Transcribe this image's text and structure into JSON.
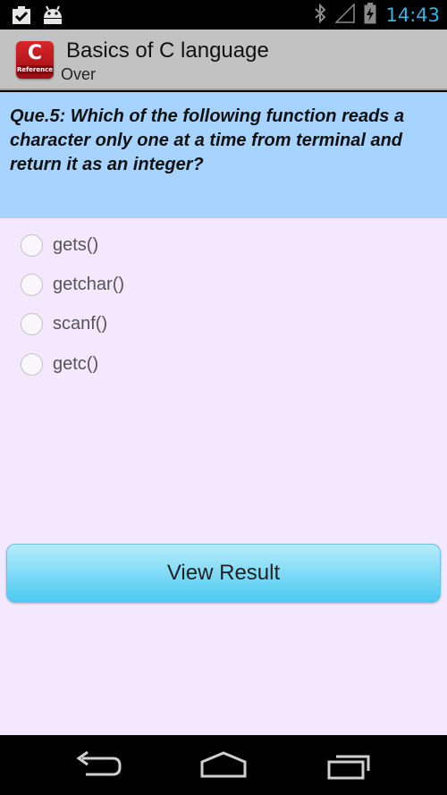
{
  "status_bar": {
    "time": "14:43",
    "icons": [
      "clipboard-check-icon",
      "android-icon",
      "bluetooth-icon",
      "signal-icon",
      "battery-charging-icon"
    ]
  },
  "action_bar": {
    "title": "Basics of C language",
    "subtitle": "Over",
    "app_icon": {
      "letter": "C",
      "caption": "Reference",
      "color": "#c4161c"
    }
  },
  "question": {
    "text": "Que.5: Which of the following function reads a character only one at a time from terminal and return it as an integer?"
  },
  "options": [
    {
      "label": "gets()",
      "selected": false
    },
    {
      "label": "getchar()",
      "selected": false
    },
    {
      "label": "scanf()",
      "selected": false
    },
    {
      "label": "getc()",
      "selected": false
    }
  ],
  "view_result_label": "View Result",
  "colors": {
    "question_bg": "#a6d3ff",
    "content_bg": "#f3e8fd",
    "button_gradient_top": "#b6ecfb",
    "button_gradient_bottom": "#4ccaf2",
    "clock": "#33b5e5"
  },
  "nav_bar": {
    "icons": [
      "back-icon",
      "home-icon",
      "recent-apps-icon"
    ]
  }
}
